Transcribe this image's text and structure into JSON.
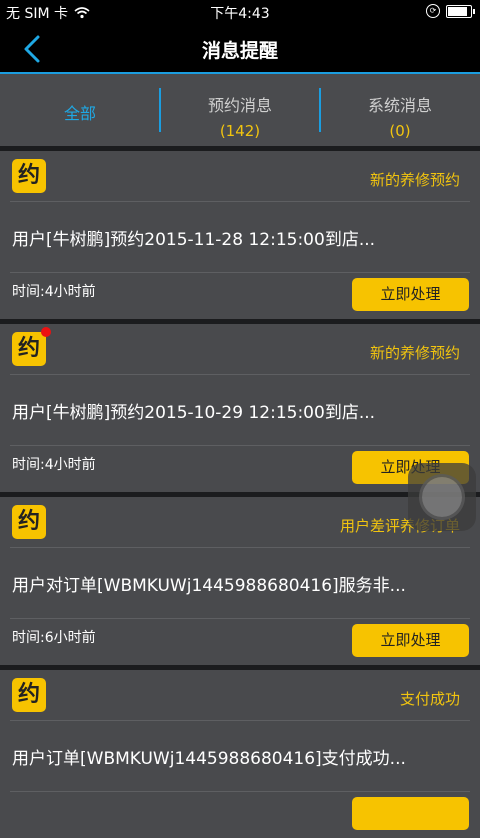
{
  "status_bar": {
    "carrier": "无 SIM 卡",
    "time": "下午4:43",
    "wifi_icon": "wifi-icon",
    "battery_level": 0.95
  },
  "nav": {
    "title": "消息提醒",
    "back_icon": "chevron-left-icon"
  },
  "tabs": [
    {
      "label": "全部",
      "count": ""
    },
    {
      "label": "预约消息",
      "count": "(142)"
    },
    {
      "label": "系统消息",
      "count": "(0)"
    }
  ],
  "colors": {
    "accent_blue": "#1b9de0",
    "accent_yellow": "#f7c300",
    "card_bg": "#494a4d",
    "unread_dot": "#ee1111"
  },
  "messages": [
    {
      "badge": "约",
      "type": "新的养修预约",
      "content": "用户[牛树鹏]预约2015-11-28 12:15:00到店...",
      "time": "时间:4小时前",
      "action": "立即处理",
      "unread": false
    },
    {
      "badge": "约",
      "type": "新的养修预约",
      "content": "用户[牛树鹏]预约2015-10-29 12:15:00到店...",
      "time": "时间:4小时前",
      "action": "立即处理",
      "unread": true
    },
    {
      "badge": "约",
      "type": "用户差评养修订单",
      "content": "用户对订单[WBMKUWj1445988680416]服务非...",
      "time": "时间:6小时前",
      "action": "立即处理",
      "unread": false
    },
    {
      "badge": "约",
      "type": "支付成功",
      "content": "用户订单[WBMKUWj1445988680416]支付成功...",
      "time": "",
      "action": "",
      "unread": false
    }
  ]
}
